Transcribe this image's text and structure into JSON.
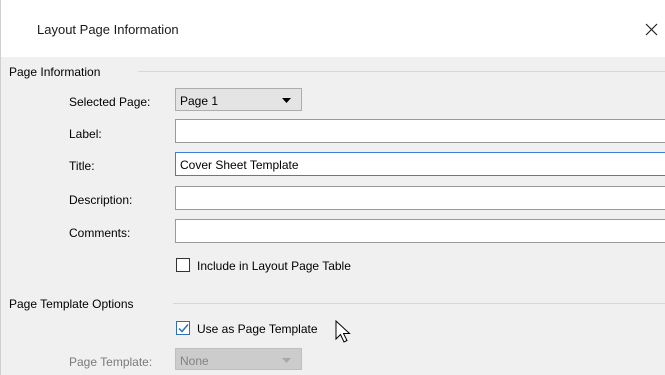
{
  "window": {
    "title": "Layout Page Information",
    "close_icon": "close-icon"
  },
  "page_information": {
    "group_label": "Page Information",
    "selected_page_label": "Selected Page:",
    "selected_page_value": "Page 1",
    "label_label": "Label:",
    "label_value": "",
    "title_label": "Title:",
    "title_value": "Cover Sheet Template",
    "description_label": "Description:",
    "description_value": "",
    "comments_label": "Comments:",
    "comments_value": "",
    "include_table_label": "Include in Layout Page Table",
    "include_table_checked": false
  },
  "page_template_options": {
    "group_label": "Page Template Options",
    "use_as_template_label": "Use as Page Template",
    "use_as_template_checked": true,
    "page_template_label": "Page Template:",
    "page_template_value": "None"
  },
  "colors": {
    "focus_border": "#3c7fd6",
    "checkbox_accent": "#2f6fb5"
  }
}
